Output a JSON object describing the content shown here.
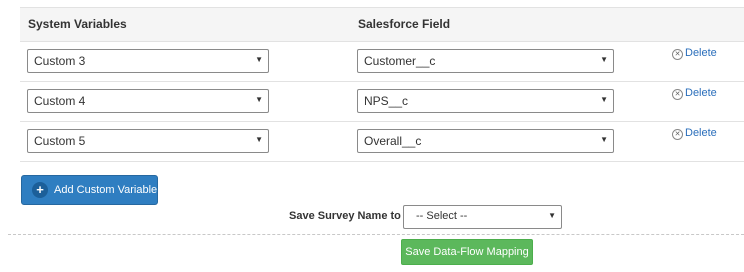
{
  "table": {
    "headers": {
      "system_variables": "System Variables",
      "salesforce_field": "Salesforce Field"
    },
    "rows": [
      {
        "system_variable": "Custom 3",
        "salesforce_field": "Customer__c",
        "delete_label": "Delete"
      },
      {
        "system_variable": "Custom 4",
        "salesforce_field": "NPS__c",
        "delete_label": "Delete"
      },
      {
        "system_variable": "Custom 5",
        "salesforce_field": "Overall__c",
        "delete_label": "Delete"
      }
    ]
  },
  "icons": {
    "dropdown": "chevron-down-icon",
    "delete": "close-circle-icon",
    "add": "plus-circle-icon"
  },
  "add_button": {
    "label": "Add Custom Variable"
  },
  "survey": {
    "label": "Save Survey Name to :",
    "select_value": "-- Select --"
  },
  "save_button": {
    "label": "Save Data-Flow Mapping"
  },
  "colors": {
    "primary_blue": "#2f7ec1",
    "success_green": "#5cb85c",
    "link_blue": "#2a6ebb",
    "header_bg": "#f5f5f5"
  }
}
